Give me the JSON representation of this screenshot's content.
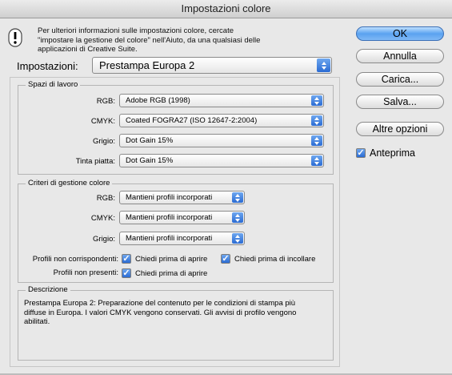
{
  "window": {
    "title": "Impostazioni colore"
  },
  "info": {
    "icon": "exclamation-icon",
    "lines": [
      "Per ulteriori informazioni sulle impostazioni colore, cercate",
      "\"impostare la gestione del colore\" nell'Aiuto, da una qualsiasi delle",
      "applicazioni di Creative Suite."
    ]
  },
  "settings": {
    "label": "Impostazioni:",
    "value": "Prestampa Europa 2"
  },
  "workspaces": {
    "title": "Spazi di lavoro",
    "rows": [
      {
        "label": "RGB:",
        "value": "Adobe RGB (1998)"
      },
      {
        "label": "CMYK:",
        "value": "Coated FOGRA27 (ISO 12647-2:2004)"
      },
      {
        "label": "Grigio:",
        "value": "Dot Gain 15%"
      },
      {
        "label": "Tinta piatta:",
        "value": "Dot Gain 15%"
      }
    ]
  },
  "policies": {
    "title": "Criteri di gestione colore",
    "rows": [
      {
        "label": "RGB:",
        "value": "Mantieni profili incorporati"
      },
      {
        "label": "CMYK:",
        "value": "Mantieni profili incorporati"
      },
      {
        "label": "Grigio:",
        "value": "Mantieni profili incorporati"
      }
    ],
    "mismatch_label": "Profili non corrispondenti:",
    "mismatch_open": {
      "label": "Chiedi prima di aprire",
      "checked": true
    },
    "mismatch_paste": {
      "label": "Chiedi prima di incollare",
      "checked": true
    },
    "missing_label": "Profili non presenti:",
    "missing_open": {
      "label": "Chiedi prima di aprire",
      "checked": true
    }
  },
  "description": {
    "title": "Descrizione",
    "lines": [
      "Prestampa Europa 2:  Preparazione del contenuto per le condizioni di stampa più",
      "diffuse in Europa. I valori CMYK vengono conservati. Gli avvisi di profilo vengono",
      "abilitati."
    ]
  },
  "buttons": {
    "ok": "OK",
    "cancel": "Annulla",
    "load": "Carica...",
    "save": "Salva...",
    "more": "Altre opzioni"
  },
  "preview": {
    "label": "Anteprima",
    "checked": true
  },
  "colors": {
    "accent": "#2a6bd3",
    "ok_button": "#5aa2f0",
    "background": "#e8e8e8"
  }
}
